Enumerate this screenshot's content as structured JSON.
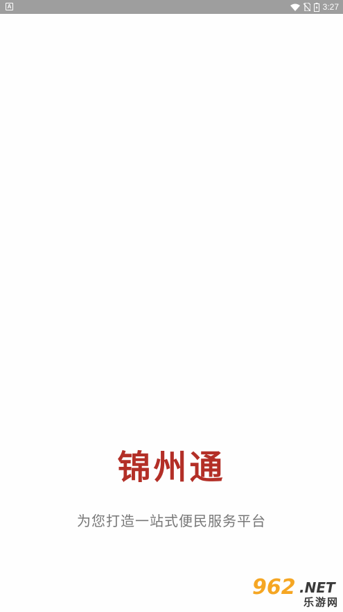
{
  "status_bar": {
    "notification_icon": "A",
    "icons": [
      "wifi-icon",
      "no-sim-icon",
      "battery-charging-icon"
    ],
    "time": "3:27"
  },
  "splash": {
    "title": "锦州通",
    "slogan": "为您打造一站式便民服务平台"
  },
  "watermark": {
    "number": "962",
    "suffix": ".NET",
    "name": "乐游网"
  },
  "colors": {
    "status_bar": "#9e9e9e",
    "title": "#b32f27",
    "slogan": "#777777",
    "watermark_orange": "#f5a623"
  }
}
